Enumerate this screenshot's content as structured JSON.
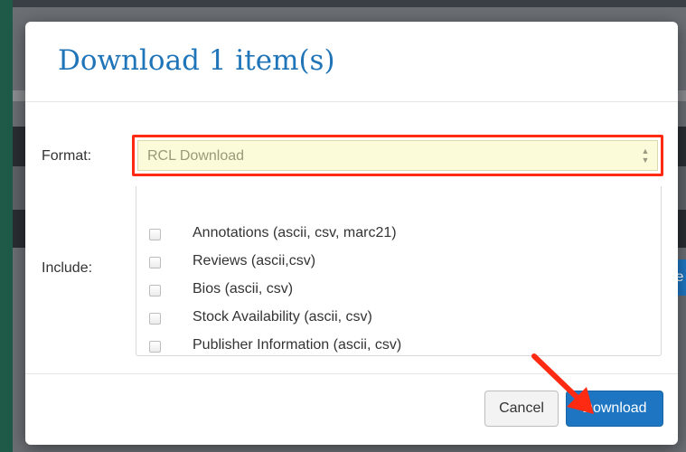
{
  "modal": {
    "title": "Download 1 item(s)",
    "format_label": "Format:",
    "format_value": "RCL Download",
    "include_label": "Include:",
    "include_options": [
      {
        "label": "Annotations (ascii, csv, marc21)",
        "checked": false
      },
      {
        "label": "Reviews (ascii,csv)",
        "checked": false
      },
      {
        "label": "Bios (ascii, csv)",
        "checked": false
      },
      {
        "label": "Stock Availability (ascii, csv)",
        "checked": false
      },
      {
        "label": "Publisher Information (ascii, csv)",
        "checked": false
      }
    ],
    "cancel_label": "Cancel",
    "download_label": "Download"
  },
  "background": {
    "partial_button_text": "te"
  },
  "colors": {
    "title": "#1f75b8",
    "primary_button": "#1e76c2",
    "highlight": "#ff2a12",
    "select_background": "#fbfbd9"
  }
}
